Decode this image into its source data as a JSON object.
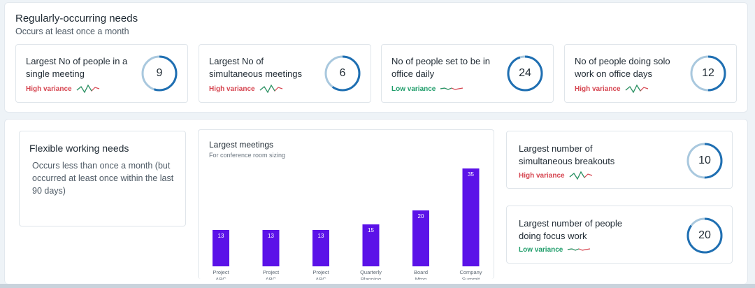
{
  "regular": {
    "title": "Regularly-occurring needs",
    "subtitle": "Occurs at least once a month",
    "cards": [
      {
        "label": "Largest No of people in a single meeting",
        "variance": "High variance",
        "variance_type": "high",
        "value": "9",
        "fill": 0.55
      },
      {
        "label": "Largest No of simultaneous meetings",
        "variance": "High variance",
        "variance_type": "high",
        "value": "6",
        "fill": 0.6
      },
      {
        "label": "No of people set to be in office daily",
        "variance": "Low variance",
        "variance_type": "low",
        "value": "24",
        "fill": 0.95
      },
      {
        "label": "No of people doing solo work on office days",
        "variance": "High variance",
        "variance_type": "high",
        "value": "12",
        "fill": 0.5
      }
    ]
  },
  "flexible": {
    "title": "Flexible working needs",
    "description": "Occurs less than once a month (but occurred at least once within the last 90 days)"
  },
  "meetings": {
    "title": "Largest meetings",
    "subtitle": "For conference room sizing"
  },
  "side_cards": [
    {
      "label": "Largest number of simultaneous breakouts",
      "variance": "High variance",
      "variance_type": "high",
      "value": "10",
      "fill": 0.5
    },
    {
      "label": "Largest number of people doing focus work",
      "variance": "Low variance",
      "variance_type": "low",
      "value": "20",
      "fill": 0.85
    }
  ],
  "colors": {
    "ring_fill": "#1f6fb2",
    "ring_track": "#a9c8de",
    "bar": "#5b12e8",
    "high_variance": "#d64550",
    "low_variance": "#1f9d6a"
  },
  "chart_data": {
    "type": "bar",
    "title": "Largest meetings",
    "subtitle": "For conference room sizing",
    "categories": [
      "Project ABC",
      "Project ABC",
      "Project ABC",
      "Quarterly Planning",
      "Board Mtng",
      "Company Summit"
    ],
    "category_lines": [
      [
        "Project",
        "ABC"
      ],
      [
        "Project",
        "ABC"
      ],
      [
        "Project",
        "ABC"
      ],
      [
        "Quarterly",
        "Planning"
      ],
      [
        "Board",
        "Mtng"
      ],
      [
        "Company",
        "Summit"
      ]
    ],
    "values": [
      13,
      13,
      13,
      15,
      20,
      35
    ],
    "ylim": [
      0,
      35
    ],
    "grid": false
  }
}
